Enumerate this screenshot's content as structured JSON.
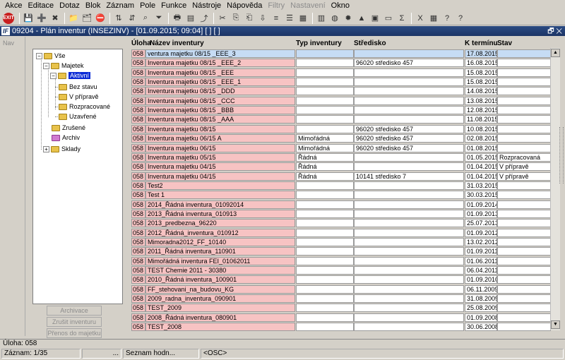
{
  "menu": [
    "Akce",
    "Editace",
    "Dotaz",
    "Blok",
    "Záznam",
    "Pole",
    "Funkce",
    "Nástroje",
    "Nápověda",
    "Filtry",
    "Nastavení",
    "Okno"
  ],
  "menu_disabled": [
    "Filtry",
    "Nastavení"
  ],
  "toolbar": {
    "exit_label": "EXIT",
    "icons": [
      "exit-icon",
      "save-icon",
      "new-record-icon",
      "delete-record-icon",
      "enter-query-icon",
      "execute-query-icon",
      "cancel-query-icon",
      "sort-asc-icon",
      "sort-desc-icon",
      "search-icon",
      "filter-icon",
      "print-icon",
      "print-preview-icon",
      "export-icon",
      "cut-icon",
      "copy-icon",
      "paste-icon",
      "fill-down-icon",
      "align-icon",
      "list-icon",
      "calculator-icon",
      "document-icon",
      "globe-icon",
      "star-icon",
      "triangle-icon",
      "table-icon",
      "screen-icon",
      "sum-icon",
      "excel-icon",
      "grid-icon",
      "user-help-icon",
      "help-icon"
    ],
    "glyphs": [
      "EXIT",
      "💾",
      "➕",
      "✖",
      "📁",
      "🗂",
      "⛔",
      "⇅",
      "⇵",
      "⌕",
      "⏷",
      "🖶",
      "▤",
      "⤴",
      "✂",
      "⎘",
      "⎗",
      "⇩",
      "≡",
      "☰",
      "▦",
      "▥",
      "◍",
      "✹",
      "▲",
      "▣",
      "▭",
      "Σ",
      "X",
      "▦",
      "?",
      "?"
    ]
  },
  "window": {
    "logo": "IF",
    "title": "09204 - Plán inventur (INSEZINV) - [01.09.2015; 09:04]  [ ]  [ ]",
    "controls": "🗗 ✕"
  },
  "nav_label": "Nav",
  "tree": {
    "all": "Vše",
    "majetek": "Majetek",
    "aktivni": "Aktivní",
    "bez_stavu": "Bez stavu",
    "v_priprave": "V přípravě",
    "rozpracovane": "Rozpracované",
    "uzavrene": "Uzavřené",
    "zrusene": "Zrušené",
    "archiv": "Archiv",
    "sklady": "Sklady"
  },
  "side_buttons": {
    "archivace": "Archivace",
    "zrusit": "Zrušit inventuru",
    "prenos": "Přenos do majetku"
  },
  "columns": {
    "uloha": "Úloha",
    "nazev": "Název inventury",
    "typ": "Typ inventury",
    "stredisko": "Středisko",
    "termin": "K termínu",
    "stav": "Stav"
  },
  "rows": [
    {
      "uloha": "058",
      "nazev": "ventura majetku 08/15 _EEE_3",
      "typ": "",
      "stredisko": "",
      "termin": "17.08.2015",
      "stav": ""
    },
    {
      "uloha": "058",
      "nazev": "Inventura majetku 08/15 _EEE_2",
      "typ": "",
      "stredisko": "96020 středisko 457",
      "termin": "16.08.2015",
      "stav": ""
    },
    {
      "uloha": "058",
      "nazev": "Inventura majetku 08/15 _EEE",
      "typ": "",
      "stredisko": "",
      "termin": "15.08.2015",
      "stav": ""
    },
    {
      "uloha": "058",
      "nazev": "Inventura majetku 08/15 _EEE_1",
      "typ": "",
      "stredisko": "",
      "termin": "15.08.2015",
      "stav": ""
    },
    {
      "uloha": "058",
      "nazev": "Inventura majetku 08/15 _DDD",
      "typ": "",
      "stredisko": "",
      "termin": "14.08.2015",
      "stav": ""
    },
    {
      "uloha": "058",
      "nazev": "Inventura majetku 08/15 _CCC",
      "typ": "",
      "stredisko": "",
      "termin": "13.08.2015",
      "stav": ""
    },
    {
      "uloha": "058",
      "nazev": "Inventura majetku 08/15 _BBB",
      "typ": "",
      "stredisko": "",
      "termin": "12.08.2015",
      "stav": ""
    },
    {
      "uloha": "058",
      "nazev": "Inventura majetku 08/15 _AAA",
      "typ": "",
      "stredisko": "",
      "termin": "11.08.2015",
      "stav": ""
    },
    {
      "uloha": "058",
      "nazev": "Inventura majetku 08/15",
      "typ": "",
      "stredisko": "96020 středisko 457",
      "termin": "10.08.2015",
      "stav": ""
    },
    {
      "uloha": "058",
      "nazev": "Inventura majetku 06/15 A",
      "typ": "Mimořádná",
      "stredisko": "96020 středisko 457",
      "termin": "02.08.2015",
      "stav": ""
    },
    {
      "uloha": "058",
      "nazev": "Inventura majetku 06/15",
      "typ": "Mimořádná",
      "stredisko": "96020 středisko 457",
      "termin": "01.08.2015",
      "stav": ""
    },
    {
      "uloha": "058",
      "nazev": "Inventura majetku 05/15",
      "typ": "Řádná",
      "stredisko": "",
      "termin": "01.05.2015",
      "stav": "Rozpracovaná"
    },
    {
      "uloha": "058",
      "nazev": "Inventura majetku 04/15",
      "typ": "Řádná",
      "stredisko": "",
      "termin": "01.04.2015",
      "stav": "V přípravě"
    },
    {
      "uloha": "058",
      "nazev": "Inventura majetku 04/15",
      "typ": "Řádná",
      "stredisko": "10141 středisko 7",
      "termin": "01.04.2015",
      "stav": "V přípravě"
    },
    {
      "uloha": "058",
      "nazev": "Test2",
      "typ": "",
      "stredisko": "",
      "termin": "31.03.2015",
      "stav": ""
    },
    {
      "uloha": "058",
      "nazev": "Test 1",
      "typ": "",
      "stredisko": "",
      "termin": "30.03.2015",
      "stav": ""
    },
    {
      "uloha": "058",
      "nazev": "2014_Řádná inventura_01092014",
      "typ": "",
      "stredisko": "",
      "termin": "01.09.2014",
      "stav": ""
    },
    {
      "uloha": "058",
      "nazev": "2013_Řádná inventura_010913",
      "typ": "",
      "stredisko": "",
      "termin": "01.09.2013",
      "stav": ""
    },
    {
      "uloha": "058",
      "nazev": "2013_predbezna_96220",
      "typ": "",
      "stredisko": "",
      "termin": "25.07.2013",
      "stav": ""
    },
    {
      "uloha": "058",
      "nazev": "2012_Řádná_inventura_010912",
      "typ": "",
      "stredisko": "",
      "termin": "01.09.2012",
      "stav": ""
    },
    {
      "uloha": "058",
      "nazev": "Mimoradna2012_FF_10140",
      "typ": "",
      "stredisko": "",
      "termin": "13.02.2012",
      "stav": ""
    },
    {
      "uloha": "058",
      "nazev": "2011_Řádná inventura_110901",
      "typ": "",
      "stredisko": "",
      "termin": "01.09.2011",
      "stav": ""
    },
    {
      "uloha": "058",
      "nazev": "Mimořádná inventura FEI_01062011",
      "typ": "",
      "stredisko": "",
      "termin": "01.06.2011",
      "stav": ""
    },
    {
      "uloha": "058",
      "nazev": "TEST Chemie 2011 - 30380",
      "typ": "",
      "stredisko": "",
      "termin": "06.04.2011",
      "stav": ""
    },
    {
      "uloha": "058",
      "nazev": "2010_Řádná inventura_100901",
      "typ": "",
      "stredisko": "",
      "termin": "01.09.2010",
      "stav": ""
    },
    {
      "uloha": "058",
      "nazev": "FF_stehovani_na_budovu_KG",
      "typ": "",
      "stredisko": "",
      "termin": "06.11.2009",
      "stav": ""
    },
    {
      "uloha": "058",
      "nazev": "2009_radna_inventura_090901",
      "typ": "",
      "stredisko": "",
      "termin": "31.08.2009",
      "stav": ""
    },
    {
      "uloha": "058",
      "nazev": "TEST_2009",
      "typ": "",
      "stredisko": "",
      "termin": "25.08.2009",
      "stav": ""
    },
    {
      "uloha": "058",
      "nazev": "2008_Řádná inventura_080901",
      "typ": "",
      "stredisko": "",
      "termin": "01.09.2008",
      "stav": ""
    },
    {
      "uloha": "058",
      "nazev": "TEST_2008",
      "typ": "",
      "stredisko": "",
      "termin": "30.06.2008",
      "stav": ""
    }
  ],
  "status": {
    "line1": "Úloha: 058",
    "zaznam": "Záznam: 1/35",
    "dots": "...",
    "seznam": "Seznam hodn...",
    "osc": "<OSC>"
  },
  "colors": {
    "row_pink": "#f7c3c3",
    "selected_row": "#c6dcf4",
    "tree_selection": "#0a2ad6",
    "title_bar": "#1d3566"
  }
}
